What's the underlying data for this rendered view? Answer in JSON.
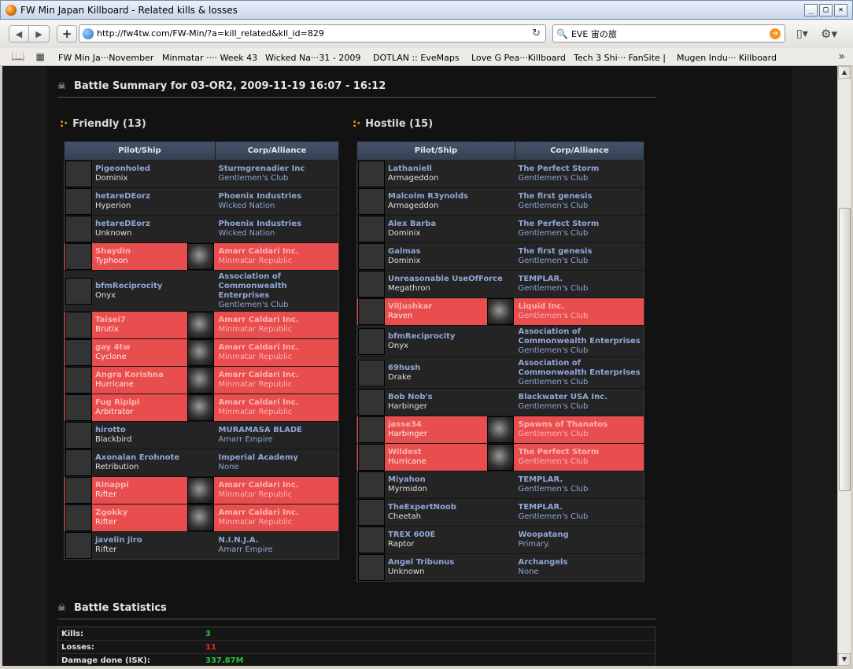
{
  "window": {
    "title": "FW Min Japan Killboard - Related kills & losses"
  },
  "nav": {
    "url": "http://fw4tw.com/FW-Min/?a=kill_related&kll_id=829",
    "search": "EVE 宙の旅"
  },
  "bookmarks": [
    "FW Min Ja···November",
    "Minmatar ···· Week 43",
    "Wicked Na···31 - 2009",
    "DOTLAN :: EveMaps",
    "Love G Pea···Killboard",
    "Tech 3 Shi··· FanSite |",
    "Mugen Indu··· Killboard"
  ],
  "summary": {
    "title": "Battle Summary for 03-OR2, 2009-11-19 16:07 - 16:12"
  },
  "friendly": {
    "title": "Friendly (13)",
    "col_pilot": "Pilot/Ship",
    "col_corp": "Corp/Alliance",
    "rows": [
      {
        "pilot": "Pigeonholed",
        "ship": "Dominix",
        "corp": "Sturmgrenadier Inc",
        "alliance": "Gentlemen's Club",
        "lost": false
      },
      {
        "pilot": "hetareDEorz",
        "ship": "Hyperion",
        "corp": "Phoenix Industries",
        "alliance": "Wicked Nation",
        "lost": false
      },
      {
        "pilot": "hetareDEorz",
        "ship": "Unknown",
        "corp": "Phoenix Industries",
        "alliance": "Wicked Nation",
        "lost": false
      },
      {
        "pilot": "Shaydin",
        "ship": "Typhoon",
        "corp": "Amarr Caldari Inc.",
        "alliance": "Minmatar Republic",
        "lost": true
      },
      {
        "pilot": "bfmReciprocity",
        "ship": "Onyx",
        "corp": "Association of Commonwealth Enterprises",
        "alliance": "Gentlemen's Club",
        "lost": false
      },
      {
        "pilot": "Taisei7",
        "ship": "Brutix",
        "corp": "Amarr Caldari Inc.",
        "alliance": "Minmatar Republic",
        "lost": true
      },
      {
        "pilot": "gay 4tw",
        "ship": "Cyclone",
        "corp": "Amarr Caldari Inc.",
        "alliance": "Minmatar Republic",
        "lost": true
      },
      {
        "pilot": "Angra Korishna",
        "ship": "Hurricane",
        "corp": "Amarr Caldari Inc.",
        "alliance": "Minmatar Republic",
        "lost": true
      },
      {
        "pilot": "Fug Riplpl",
        "ship": "Arbitrator",
        "corp": "Amarr Caldari Inc.",
        "alliance": "Minmatar Republic",
        "lost": true
      },
      {
        "pilot": "hirotto",
        "ship": "Blackbird",
        "corp": "MURAMASA BLADE",
        "alliance": "Amarr Empire",
        "lost": false
      },
      {
        "pilot": "Axonalan Erohnote",
        "ship": "Retribution",
        "corp": "Imperial Academy",
        "alliance": "None",
        "lost": false
      },
      {
        "pilot": "Rinappi",
        "ship": "Rifter",
        "corp": "Amarr Caldari Inc.",
        "alliance": "Minmatar Republic",
        "lost": true
      },
      {
        "pilot": "Zgokky",
        "ship": "Rifter",
        "corp": "Amarr Caldari Inc.",
        "alliance": "Minmatar Republic",
        "lost": true
      },
      {
        "pilot": "javelin jiro",
        "ship": "Rifter",
        "corp": "N.I.N.J.A.",
        "alliance": "Amarr Empire",
        "lost": false
      }
    ]
  },
  "hostile": {
    "title": "Hostile (15)",
    "col_pilot": "Pilot/Ship",
    "col_corp": "Corp/Alliance",
    "rows": [
      {
        "pilot": "Lathaniell",
        "ship": "Armageddon",
        "corp": "The Perfect Storm",
        "alliance": "Gentlemen's Club",
        "lost": false
      },
      {
        "pilot": "Malcolm R3ynolds",
        "ship": "Armageddon",
        "corp": "The first genesis",
        "alliance": "Gentlemen's Club",
        "lost": false
      },
      {
        "pilot": "Alex Barba",
        "ship": "Dominix",
        "corp": "The Perfect Storm",
        "alliance": "Gentlemen's Club",
        "lost": false
      },
      {
        "pilot": "Galmas",
        "ship": "Dominix",
        "corp": "The first genesis",
        "alliance": "Gentlemen's Club",
        "lost": false
      },
      {
        "pilot": "Unreasonable UseOfForce",
        "ship": "Megathron",
        "corp": "TEMPLAR.",
        "alliance": "Gentlemen's Club",
        "lost": false
      },
      {
        "pilot": "Viljushkar",
        "ship": "Raven",
        "corp": "Liquid Inc.",
        "alliance": "Gentlemen's Club",
        "lost": true
      },
      {
        "pilot": "bfmReciprocity",
        "ship": "Onyx",
        "corp": "Association of Commonwealth Enterprises",
        "alliance": "Gentlemen's Club",
        "lost": false
      },
      {
        "pilot": "69hush",
        "ship": "Drake",
        "corp": "Association of Commonwealth Enterprises",
        "alliance": "Gentlemen's Club",
        "lost": false
      },
      {
        "pilot": "Bob Nob's",
        "ship": "Harbinger",
        "corp": "Blackwater USA Inc.",
        "alliance": "Gentlemen's Club",
        "lost": false
      },
      {
        "pilot": "jasse34",
        "ship": "Harbinger",
        "corp": "Spawns of Thanatos",
        "alliance": "Gentlemen's Club",
        "lost": true
      },
      {
        "pilot": "Wildest",
        "ship": "Hurricane",
        "corp": "The Perfect Storm",
        "alliance": "Gentlemen's Club",
        "lost": true
      },
      {
        "pilot": "Miyahon",
        "ship": "Myrmidon",
        "corp": "TEMPLAR.",
        "alliance": "Gentlemen's Club",
        "lost": false
      },
      {
        "pilot": "TheExpertNoob",
        "ship": "Cheetah",
        "corp": "TEMPLAR.",
        "alliance": "Gentlemen's Club",
        "lost": false
      },
      {
        "pilot": "TREX 600E",
        "ship": "Raptor",
        "corp": "Woopatang",
        "alliance": "Primary.",
        "lost": false
      },
      {
        "pilot": "Angel Tribunus",
        "ship": "Unknown",
        "corp": "Archangels",
        "alliance": "None",
        "lost": false
      }
    ]
  },
  "stats": {
    "title": "Battle Statistics",
    "rows": [
      {
        "label": "Kills:",
        "value": "3",
        "color": "#27c23a"
      },
      {
        "label": "Losses:",
        "value": "11",
        "color": "#e52b2b"
      },
      {
        "label": "Damage done (ISK):",
        "value": "337.87M",
        "color": "#27c23a"
      }
    ]
  },
  "colors": {
    "loss_row": "#e84e4e",
    "link": "#8fa7d6",
    "header": "#3c4a5e"
  }
}
